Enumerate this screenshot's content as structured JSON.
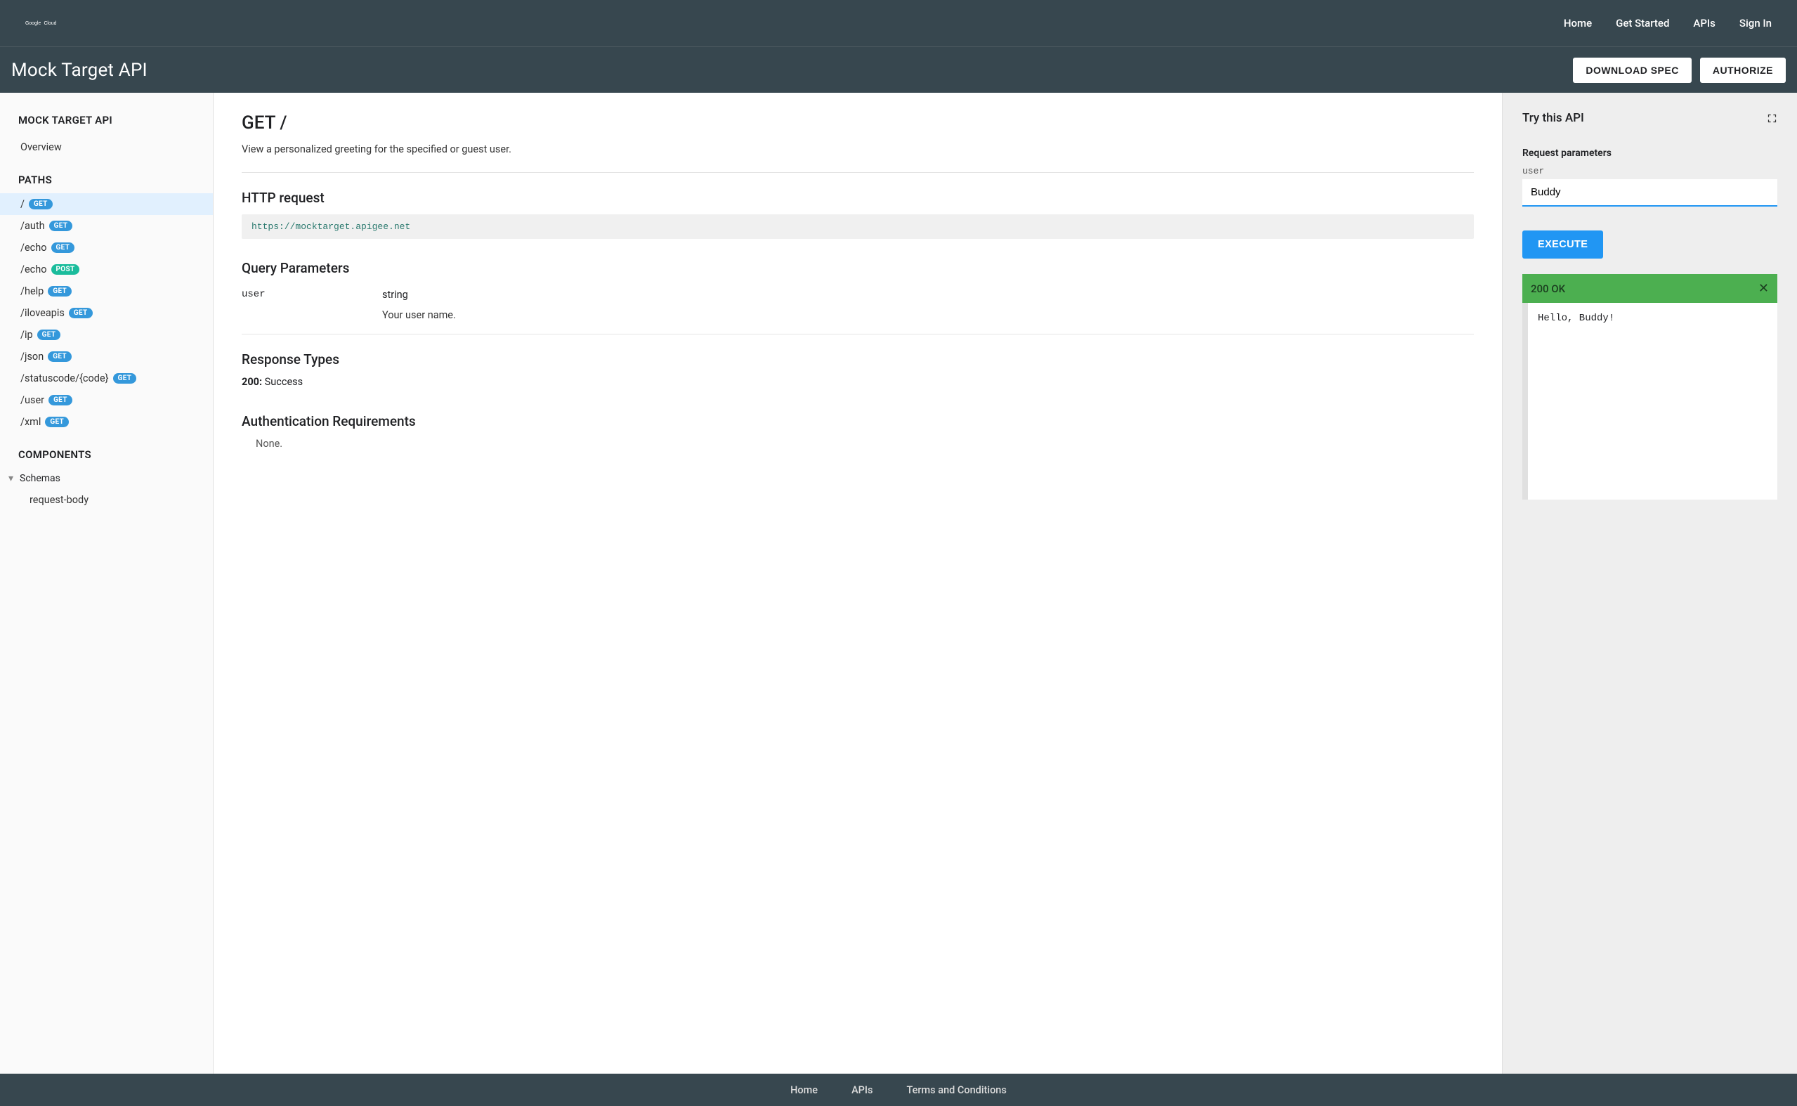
{
  "topnav": {
    "logo_text": "Google Cloud",
    "links": [
      "Home",
      "Get Started",
      "APIs",
      "Sign In"
    ]
  },
  "subheader": {
    "title": "Mock Target API",
    "download_btn": "DOWNLOAD SPEC",
    "authorize_btn": "AUTHORIZE"
  },
  "sidebar": {
    "api_title": "MOCK TARGET API",
    "overview": "Overview",
    "paths_label": "PATHS",
    "paths": [
      {
        "path": "/",
        "method": "GET",
        "active": true
      },
      {
        "path": "/auth",
        "method": "GET"
      },
      {
        "path": "/echo",
        "method": "GET"
      },
      {
        "path": "/echo",
        "method": "POST"
      },
      {
        "path": "/help",
        "method": "GET"
      },
      {
        "path": "/iloveapis",
        "method": "GET"
      },
      {
        "path": "/ip",
        "method": "GET"
      },
      {
        "path": "/json",
        "method": "GET"
      },
      {
        "path": "/statuscode/{code}",
        "method": "GET"
      },
      {
        "path": "/user",
        "method": "GET"
      },
      {
        "path": "/xml",
        "method": "GET"
      }
    ],
    "components_label": "COMPONENTS",
    "schemas_label": "Schemas",
    "schema_children": [
      "request-body"
    ]
  },
  "doc": {
    "heading": "GET /",
    "description": "View a personalized greeting for the specified or guest user.",
    "http_request_label": "HTTP request",
    "http_request_url": "https://mocktarget.apigee.net",
    "query_params_label": "Query Parameters",
    "params": [
      {
        "name": "user",
        "type": "string",
        "desc": "Your user name."
      }
    ],
    "response_types_label": "Response Types",
    "responses": [
      {
        "code": "200:",
        "text": "Success"
      }
    ],
    "auth_label": "Authentication Requirements",
    "auth_text": "None."
  },
  "try": {
    "title": "Try this API",
    "request_params_label": "Request parameters",
    "field_label": "user",
    "field_value": "Buddy",
    "execute_btn": "EXECUTE",
    "status": "200 OK",
    "response_body": "Hello, Buddy!"
  },
  "footer": {
    "links": [
      "Home",
      "APIs",
      "Terms and Conditions"
    ]
  }
}
